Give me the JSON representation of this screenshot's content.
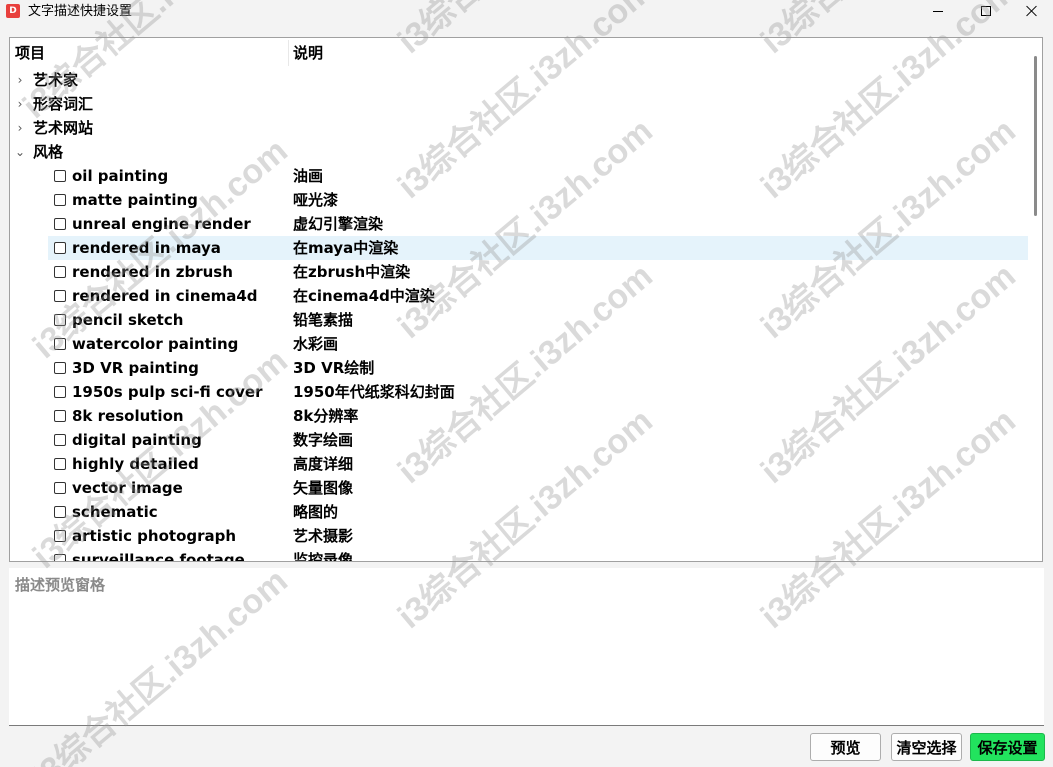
{
  "window": {
    "title": "文字描述快捷设置",
    "icon": "app-icon"
  },
  "tree": {
    "columns": [
      "项目",
      "说明"
    ],
    "categories": [
      {
        "label": "艺术家",
        "expanded": false
      },
      {
        "label": "形容词汇",
        "expanded": false
      },
      {
        "label": "艺术网站",
        "expanded": false
      },
      {
        "label": "风格",
        "expanded": true
      }
    ],
    "items": [
      {
        "label": "oil painting",
        "desc": "油画",
        "checked": false
      },
      {
        "label": "matte painting",
        "desc": "哑光漆",
        "checked": false
      },
      {
        "label": "unreal engine render",
        "desc": "虚幻引擎渲染",
        "checked": false
      },
      {
        "label": "rendered in maya",
        "desc": "在maya中渲染",
        "checked": false,
        "highlighted": true
      },
      {
        "label": "rendered in zbrush",
        "desc": "在zbrush中渲染",
        "checked": false
      },
      {
        "label": "rendered in cinema4d",
        "desc": "在cinema4d中渲染",
        "checked": false
      },
      {
        "label": "pencil sketch",
        "desc": "铅笔素描",
        "checked": false
      },
      {
        "label": "watercolor painting",
        "desc": "水彩画",
        "checked": false
      },
      {
        "label": "3D VR painting",
        "desc": "3D VR绘制",
        "checked": false
      },
      {
        "label": "1950s pulp sci-fi cover",
        "desc": "1950年代纸浆科幻封面",
        "checked": false
      },
      {
        "label": "8k resolution",
        "desc": "8k分辨率",
        "checked": false
      },
      {
        "label": "digital painting",
        "desc": "数字绘画",
        "checked": false
      },
      {
        "label": "highly detailed",
        "desc": "高度详细",
        "checked": false
      },
      {
        "label": "vector image",
        "desc": "矢量图像",
        "checked": false
      },
      {
        "label": "schematic",
        "desc": "略图的",
        "checked": false
      },
      {
        "label": "artistic photograph",
        "desc": "艺术摄影",
        "checked": false
      },
      {
        "label": "surveillance footage",
        "desc": "监控录像",
        "checked": false
      }
    ]
  },
  "preview": {
    "placeholder": "描述预览窗格"
  },
  "buttons": {
    "preview": "预览",
    "clear": "清空选择",
    "save": "保存设置"
  },
  "watermark": "i3综合社区.i3zh.com",
  "colors": {
    "save_button": "#22e35e",
    "row_highlight": "#e5f3fb",
    "title_icon": "#e8403d"
  }
}
